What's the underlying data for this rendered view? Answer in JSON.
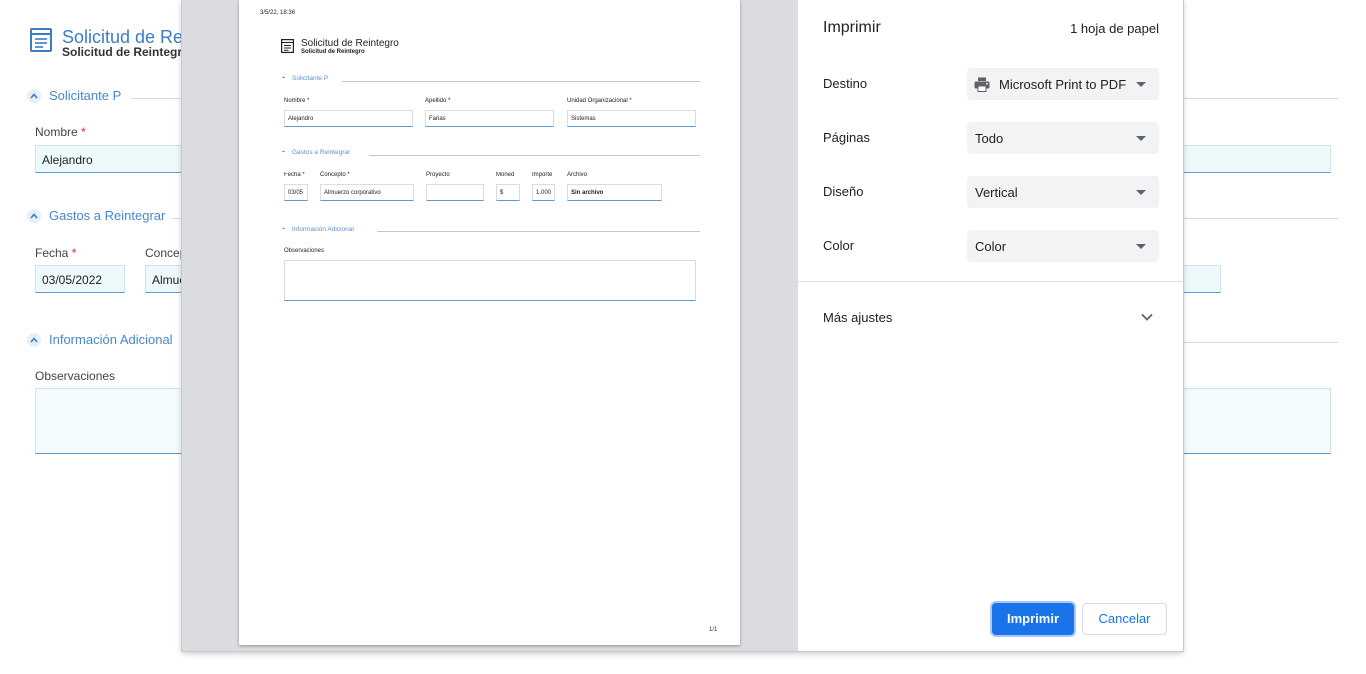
{
  "form": {
    "title": "Solicitud de Rei",
    "subtitle": "Solicitud de Reintegro",
    "sections": {
      "solicitante": "Solicitante P",
      "gastos": "Gastos a Reintegrar",
      "info": "Información Adicional"
    },
    "fields": {
      "nombre_label": "Nombre",
      "nombre_value": "Alejandro",
      "fecha_label": "Fecha",
      "fecha_value": "03/05/2022",
      "concepto_label": "Concep",
      "concepto_value": "Almue",
      "observaciones_label": "Observaciones"
    },
    "required_mark": "*"
  },
  "preview": {
    "date_header": "3/5/22, 18:36",
    "title": "Solicitud de Reintegro",
    "subtitle": "Solicitud de Reintegro",
    "sections": {
      "solicitante": "Solicitante P",
      "gastos": "Gastos a Reintegrar",
      "info": "Información Adicional"
    },
    "fields": {
      "nombre_label": "Nombre *",
      "nombre_value": "Alejandro",
      "apellido_label": "Apellido *",
      "apellido_value": "Farias",
      "unidad_label": "Unidad Organizacional *",
      "unidad_value": "Sistemas",
      "fecha_label": "Fecha *",
      "fecha_value": "03/05",
      "concepto_label": "Concepto *",
      "concepto_value": "Almuerzo corporativo",
      "proyecto_label": "Proyecto",
      "proyecto_value": "",
      "moneda_label": "Moned",
      "moneda_value": "$",
      "importe_label": "Importe",
      "importe_value": "1.000",
      "archivo_label": "Archivo",
      "archivo_value": "Sin archivo",
      "observaciones_label": "Observaciones"
    },
    "page_number": "1/1"
  },
  "print_settings": {
    "title": "Imprimir",
    "sheet_count": "1 hoja de papel",
    "destino_label": "Destino",
    "destino_value": "Microsoft Print to PDF",
    "paginas_label": "Páginas",
    "paginas_value": "Todo",
    "diseno_label": "Diseño",
    "diseno_value": "Vertical",
    "color_label": "Color",
    "color_value": "Color",
    "more_settings_label": "Más ajustes",
    "print_button": "Imprimir",
    "cancel_button": "Cancelar"
  },
  "colors": {
    "accent": "#1a73e8",
    "form_link": "#3c7dc4",
    "preview_bg": "#dadce0"
  },
  "icons": [
    "form-icon",
    "chevron-up-icon",
    "printer-icon",
    "dropdown-caret-icon",
    "chevron-down-icon"
  ]
}
